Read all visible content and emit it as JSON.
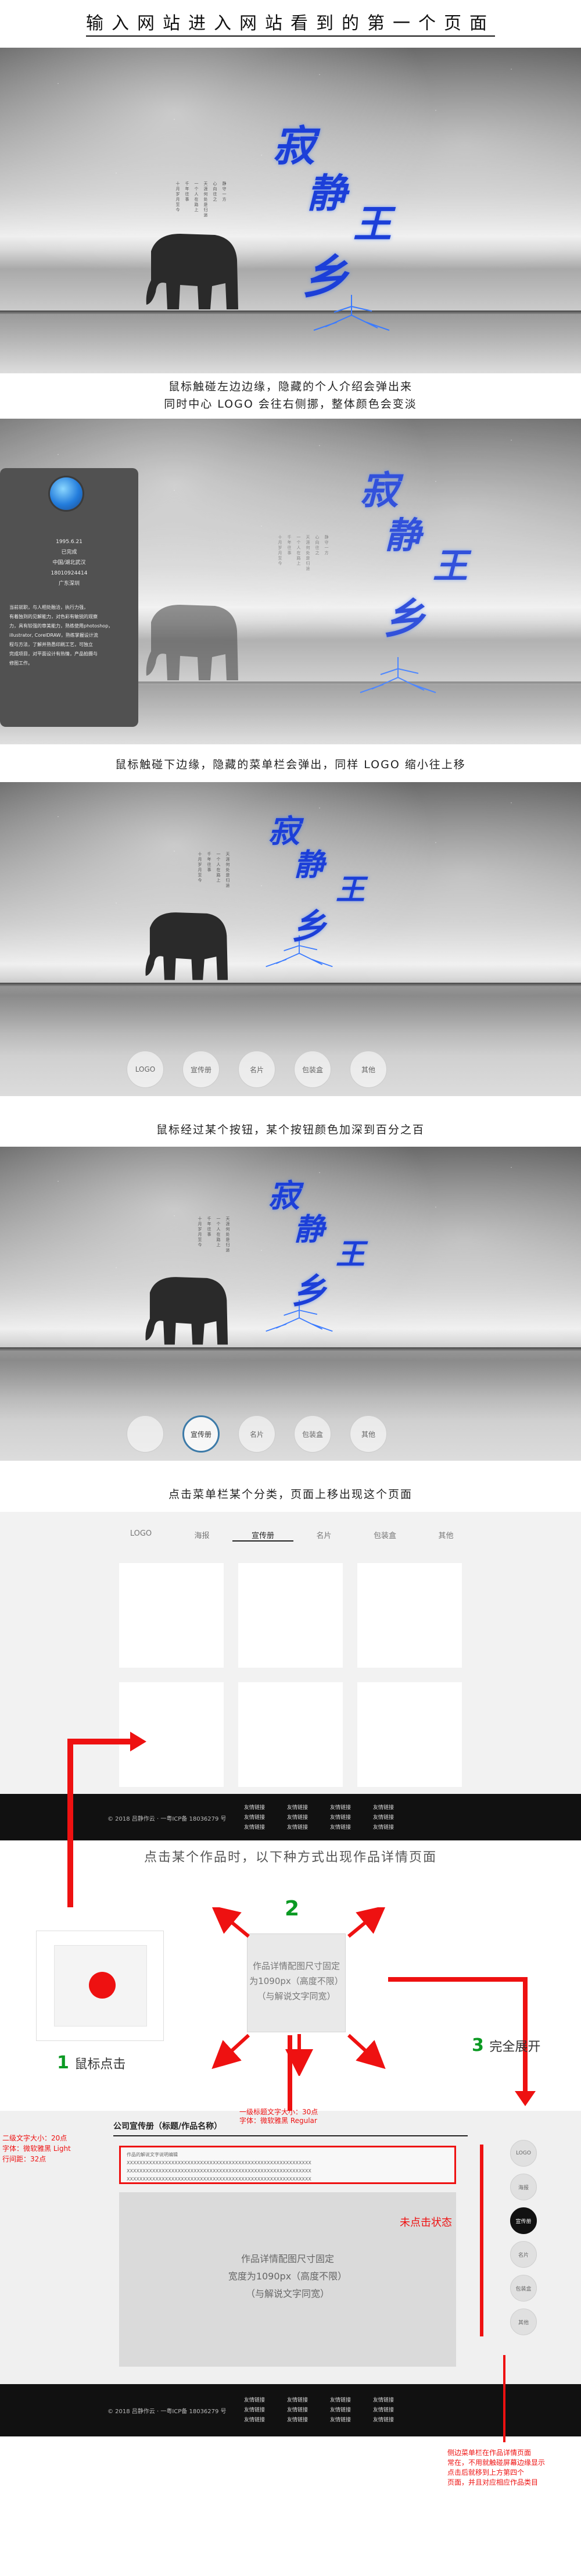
{
  "header": {
    "title": "输入网站进入网站看到的第一个页面"
  },
  "hero": {
    "calligraphy": [
      "寂",
      "静",
      "王",
      "乡"
    ],
    "poem_lines": [
      "十月岁月至今",
      "千年往事",
      "一个人在路上",
      "天涯何处是归途",
      "心向往之",
      "静守一方",
      "寂静之地"
    ]
  },
  "captions": {
    "c1a": "鼠标触碰左边边缘，隐藏的个人介绍会弹出来",
    "c1b": "同时中心 LOGO 会往右侧挪，整体颜色会变淡",
    "c2": "鼠标触碰下边缘，隐藏的菜单栏会弹出，同样 LOGO 缩小往上移",
    "c3": "鼠标经过某个按钮，某个按钮颜色加深到百分之百",
    "c4": "点击菜单栏某个分类，页面上移出现这个页面",
    "c5": "点击某个作品时，以下种方式出现作品详情页面"
  },
  "profile": {
    "date": "1995.6.21",
    "sign": "已完成",
    "school": "中国/湖北武汉",
    "phone": "18010924414",
    "region": "广东深圳",
    "bio": [
      "当前就职，与人相处融洽，执行力强，",
      "有着独到的见解能力，对色彩有敏锐的观察",
      "力，具有较强的审美能力，熟练使用photoshop，",
      "illustrator, CorelDRAW，熟练掌握设计流",
      "程与方法，了解并熟悉印刷工艺，可独立",
      "完成项目，对平面设计有热情，产品拍摄与",
      "修图工作。"
    ]
  },
  "menu": {
    "items": [
      "LOGO",
      "宣传册",
      "名片",
      "包装盒",
      "其他"
    ],
    "active_index_step4": 1
  },
  "gallery": {
    "tabs": [
      "LOGO",
      "海报",
      "宣传册",
      "名片",
      "包装盒",
      "其他"
    ],
    "active_tab": 2
  },
  "footer": {
    "copyright": "© 2018 吕静作云 · 一粤ICP备 18036279 号",
    "link_text": "友情链接"
  },
  "transition": {
    "step1": "鼠标点击",
    "step2": "2",
    "step3": "完全展开",
    "num1": "1",
    "num3": "3",
    "box_text": [
      "作品详情配图尺寸固定",
      "为1090px（高度不限）",
      "（与解说文字同宽）"
    ]
  },
  "detail": {
    "title": "公司宣传册（标题/作品名称）",
    "anno_title": [
      "一级标题文字大小：30点",
      "字体：微软雅黑 Regular"
    ],
    "anno_body": [
      "二级文字大小：20点",
      "字体：微软雅黑 Light",
      "行间距：32点"
    ],
    "desc_label": "作品的解说文字说明编辑",
    "desc_placeholder": "XXXXXXXXXXXXXXXXXXXXXXXXXXXXXXXXXXXXXXXXXXXXXXXXXXXXXXXXXX",
    "image_text": [
      "作品详情配图尺寸固定",
      "宽度为1090px（高度不限）",
      "（与解说文字同宽）"
    ],
    "side_items": [
      "LOGO",
      "海报",
      "宣传册",
      "名片",
      "包装盒",
      "其他"
    ],
    "unclicked": "未点击状态",
    "notes": [
      "侧边菜单栏在作品详情页面",
      "常在，不用就触碰屏幕边缘显示",
      "点击后就移到上方第四个",
      "页面，并且对应相应作品类目"
    ]
  }
}
